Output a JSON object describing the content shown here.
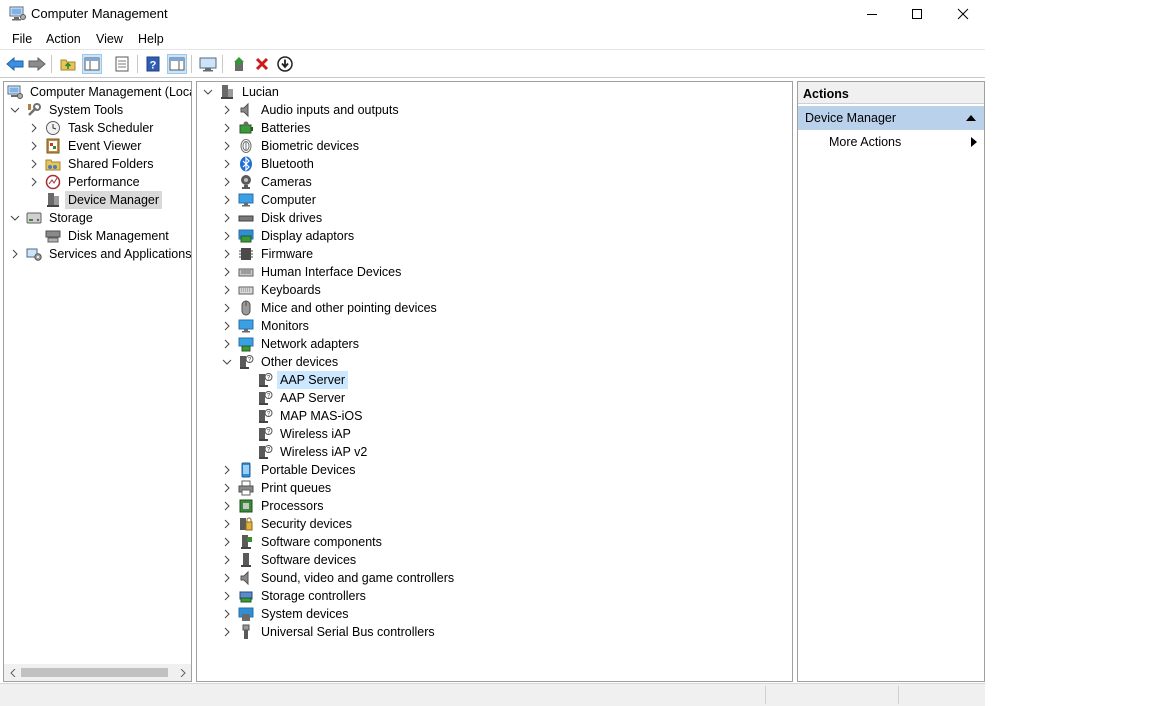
{
  "window": {
    "title": "Computer Management"
  },
  "menu": [
    "File",
    "Action",
    "View",
    "Help"
  ],
  "toolbar": {
    "buttons": [
      "back-icon",
      "forward-icon",
      "up-folder-icon",
      "show-hide-tree-icon",
      "properties-icon",
      "help-icon",
      "show-action-pane-icon",
      "scan-hardware-icon",
      "update-driver-icon",
      "uninstall-icon",
      "disable-device-icon"
    ]
  },
  "left_tree": {
    "root": "Computer Management (Local",
    "items": [
      {
        "label": "System Tools",
        "level": 1,
        "expanded": true,
        "icon": "tools-icon"
      },
      {
        "label": "Task Scheduler",
        "level": 2,
        "icon": "clock-icon"
      },
      {
        "label": "Event Viewer",
        "level": 2,
        "icon": "event-viewer-icon"
      },
      {
        "label": "Shared Folders",
        "level": 2,
        "icon": "shared-folder-icon"
      },
      {
        "label": "Performance",
        "level": 2,
        "icon": "performance-icon"
      },
      {
        "label": "Device Manager",
        "level": 2,
        "icon": "device-manager-icon",
        "selected": true
      },
      {
        "label": "Storage",
        "level": 1,
        "expanded": true,
        "icon": "storage-icon"
      },
      {
        "label": "Disk Management",
        "level": 2,
        "icon": "disk-management-icon"
      },
      {
        "label": "Services and Applications",
        "level": 1,
        "icon": "services-icon"
      }
    ]
  },
  "device_tree": {
    "root": "Lucian",
    "categories": [
      "Audio inputs and outputs",
      "Batteries",
      "Biometric devices",
      "Bluetooth",
      "Cameras",
      "Computer",
      "Disk drives",
      "Display adaptors",
      "Firmware",
      "Human Interface Devices",
      "Keyboards",
      "Mice and other pointing devices",
      "Monitors",
      "Network adapters",
      "Other devices"
    ],
    "other_devices": [
      "AAP Server",
      "AAP Server",
      "MAP MAS-iOS",
      "Wireless iAP",
      "Wireless iAP v2"
    ],
    "categories_after": [
      "Portable Devices",
      "Print queues",
      "Processors",
      "Security devices",
      "Software components",
      "Software devices",
      "Sound, video and game controllers",
      "Storage controllers",
      "System devices",
      "Universal Serial Bus controllers"
    ]
  },
  "actions": {
    "header": "Actions",
    "section": "Device Manager",
    "item": "More Actions"
  },
  "colors": {
    "selection_gray": "#d9d9d9",
    "selection_blue": "#cce8ff",
    "actions_section": "#b9d1ea"
  }
}
